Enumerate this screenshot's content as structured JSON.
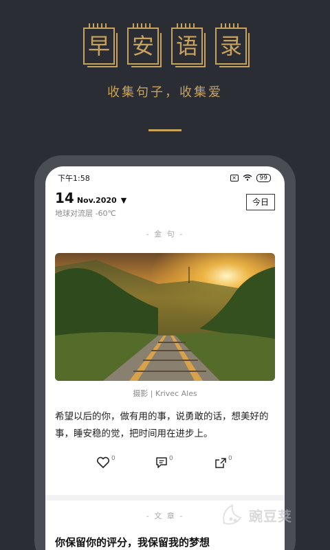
{
  "header": {
    "title_chars": [
      "早",
      "安",
      "语",
      "录"
    ],
    "subtitle": "收集句子，收集爱"
  },
  "status_bar": {
    "time": "下午1:58",
    "battery": "99"
  },
  "date": {
    "day": "14",
    "month_year": "Nov.2020",
    "location_weather": "地球对流层 -60℃",
    "today_button": "今日"
  },
  "sections": {
    "quote_label": "- 金 句 -",
    "article_label": "- 文 章 -"
  },
  "photo": {
    "caption": "摄影 | Krivec Ales"
  },
  "quote": {
    "text": "希望以后的你，做有用的事，说勇敢的话，想美好的事，睡安稳的觉，把时间用在进步上。"
  },
  "actions": {
    "like_count": "0",
    "comment_count": "0",
    "share_count": "0"
  },
  "article": {
    "title": "你保留你的评分，我保留我的梦想"
  },
  "watermark": {
    "text": "豌豆荚"
  },
  "colors": {
    "background": "#2b2d35",
    "gold": "#c9a35c",
    "phone_frame": "#4b4d55"
  }
}
